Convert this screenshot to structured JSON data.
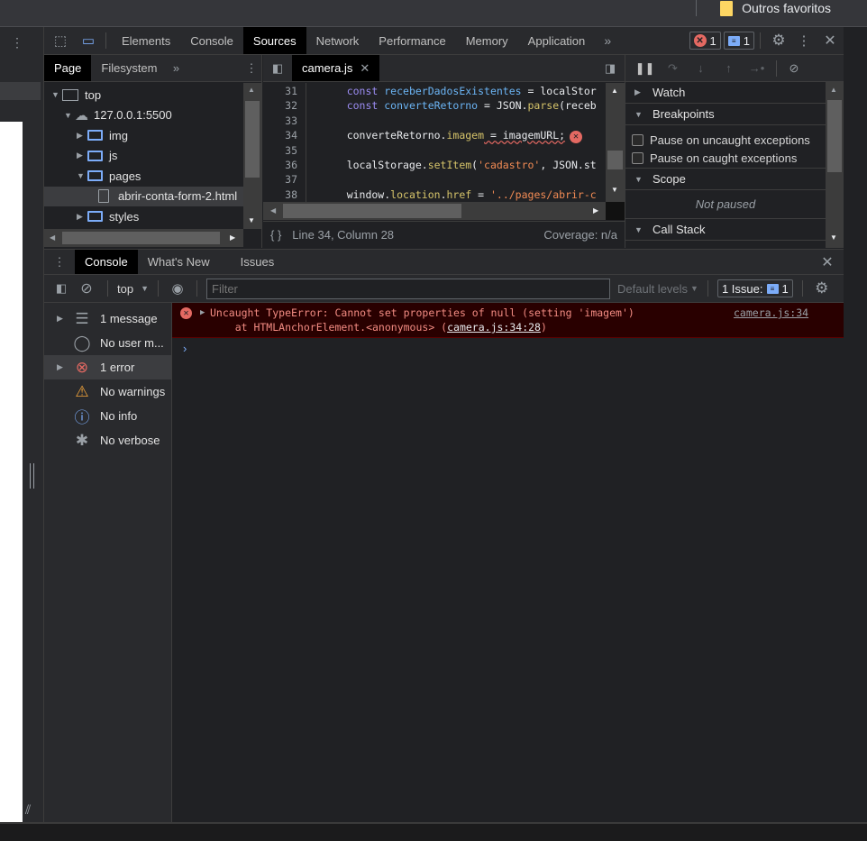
{
  "browser": {
    "bookmark_folder": "Outros favoritos"
  },
  "devtools": {
    "tabs": [
      "Elements",
      "Console",
      "Sources",
      "Network",
      "Performance",
      "Memory",
      "Application"
    ],
    "active_tab": "Sources",
    "error_count": "1",
    "message_count": "1"
  },
  "navigator": {
    "tabs": [
      "Page",
      "Filesystem"
    ],
    "tree": [
      {
        "label": "top",
        "icon": "frame-icon",
        "expanded": true
      },
      {
        "label": "127.0.0.1:5500",
        "icon": "cloud-icon",
        "expanded": true
      },
      {
        "label": "img",
        "icon": "folder-icon",
        "expanded": false
      },
      {
        "label": "js",
        "icon": "folder-icon",
        "expanded": false
      },
      {
        "label": "pages",
        "icon": "folder-icon",
        "expanded": true
      },
      {
        "label": "abrir-conta-form-2.html",
        "icon": "file-icon",
        "selected": true
      },
      {
        "label": "styles",
        "icon": "folder-icon",
        "expanded": false
      }
    ]
  },
  "editor": {
    "file_tab": "camera.js",
    "lines": [
      {
        "n": "31",
        "code": [
          [
            "kw",
            "    const "
          ],
          [
            "var",
            "receberDadosExistentes"
          ],
          [
            "pl",
            " = localStor"
          ]
        ]
      },
      {
        "n": "32",
        "code": [
          [
            "kw",
            "    const "
          ],
          [
            "var",
            "converteRetorno"
          ],
          [
            "pl",
            " = JSON."
          ],
          [
            "fn",
            "parse"
          ],
          [
            "pl",
            "(receb"
          ]
        ]
      },
      {
        "n": "33",
        "code": []
      },
      {
        "n": "34",
        "code": [
          [
            "pl",
            "    converteRetorno."
          ],
          [
            "fn",
            "imagem"
          ],
          [
            "pl",
            " = imagemURL;"
          ]
        ]
      },
      {
        "n": "35",
        "code": []
      },
      {
        "n": "36",
        "code": [
          [
            "pl",
            "    localStorage."
          ],
          [
            "fn",
            "setItem"
          ],
          [
            "pl",
            "("
          ],
          [
            "str",
            "'cadastro'"
          ],
          [
            "pl",
            ", JSON.st"
          ]
        ]
      },
      {
        "n": "37",
        "code": []
      },
      {
        "n": "38",
        "code": [
          [
            "pl",
            "    window."
          ],
          [
            "fn",
            "location"
          ],
          [
            "pl",
            "."
          ],
          [
            "fn",
            "href"
          ],
          [
            "pl",
            " = "
          ],
          [
            "str",
            "'../pages/abrir-c"
          ]
        ]
      }
    ],
    "status_position": "Line 34, Column 28",
    "coverage": "Coverage: n/a"
  },
  "debugger": {
    "watch": "Watch",
    "breakpoints": "Breakpoints",
    "pause_uncaught": "Pause on uncaught exceptions",
    "pause_caught": "Pause on caught exceptions",
    "scope": "Scope",
    "not_paused": "Not paused",
    "call_stack": "Call Stack"
  },
  "drawer": {
    "tabs": [
      "Console",
      "What's New",
      "Issues"
    ],
    "context": "top",
    "filter_placeholder": "Filter",
    "levels": "Default levels",
    "issues_label": "1 Issue:",
    "issues_count": "1",
    "sidebar": [
      {
        "label": "1 message",
        "icon": "list-icon",
        "expandable": true
      },
      {
        "label": "No user m...",
        "icon": "user-icon"
      },
      {
        "label": "1 error",
        "icon": "error-icon",
        "expandable": true,
        "selected": true
      },
      {
        "label": "No warnings",
        "icon": "warning-icon"
      },
      {
        "label": "No info",
        "icon": "info-icon"
      },
      {
        "label": "No verbose",
        "icon": "bug-icon"
      }
    ],
    "error": {
      "message": "Uncaught TypeError: Cannot set properties of null (setting 'imagem')",
      "stack_prefix": "    at HTMLAnchorElement.<anonymous> (",
      "stack_link": "camera.js:34:28",
      "stack_suffix": ")",
      "source_link": "camera.js:34"
    },
    "colors": {
      "error_bg": "#290000",
      "error_text": "#f28b82"
    }
  }
}
